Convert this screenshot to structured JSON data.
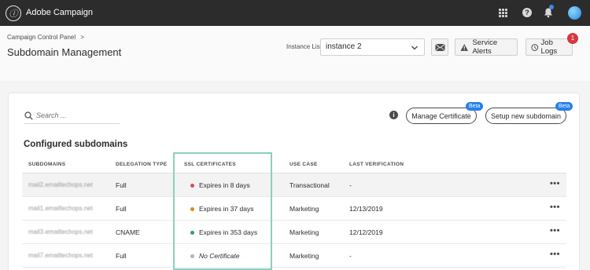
{
  "app": {
    "title": "Adobe Campaign"
  },
  "header": {
    "breadcrumb": "Campaign Control Panel",
    "breadcrumb_sep": ">",
    "title": "Subdomain Management",
    "instance_label": "Instance List",
    "instance_value": "instance 2",
    "service_alerts_label": "Service Alerts",
    "job_logs_label": "Job Logs",
    "notification_count": "1"
  },
  "toolbar": {
    "search_placeholder": "Search ...",
    "manage_certificate_label": "Manage Certificate",
    "setup_subdomain_label": "Setup new subdomain",
    "beta_label": "Beta",
    "info_glyph": "i"
  },
  "section_title": "Configured subdomains",
  "table": {
    "columns": [
      "SUBDOMAINS",
      "DELEGATION TYPE",
      "SSL CERTIFICATES",
      "USE CASE",
      "LAST VERIFICATION"
    ],
    "rows": [
      {
        "subdomain": "mail2.emailtechops.net",
        "delegation": "Full",
        "ssl": "Expires in 8 days",
        "ssl_color": "#e34850",
        "use_case": "Transactional",
        "last_verification": "-"
      },
      {
        "subdomain": "mail1.emailtechops.net",
        "delegation": "Full",
        "ssl": "Expires in 37 days",
        "ssl_color": "#e68619",
        "use_case": "Marketing",
        "last_verification": "12/13/2019"
      },
      {
        "subdomain": "mail3.emailtechops.net",
        "delegation": "CNAME",
        "ssl": "Expires in 353 days",
        "ssl_color": "#2d9d78",
        "use_case": "Marketing",
        "last_verification": "12/12/2019"
      },
      {
        "subdomain": "mail7.emailtechops.net",
        "delegation": "Full",
        "ssl": "No Certificate",
        "ssl_color": "#b3b3b3",
        "use_case": "Marketing",
        "last_verification": "-"
      }
    ],
    "more_glyph": "•••"
  },
  "colors": {
    "topbar": "#2c2c2c",
    "accent": "#2680eb",
    "highlight": "#8ccfc0",
    "badge": "#d7373f"
  },
  "icons": [
    "adobe-campaign-logo",
    "app-grid-icon",
    "help-icon",
    "bell-icon",
    "avatar",
    "mail-icon",
    "alert-icon",
    "history-icon",
    "search-icon",
    "info-icon",
    "more-icon"
  ]
}
